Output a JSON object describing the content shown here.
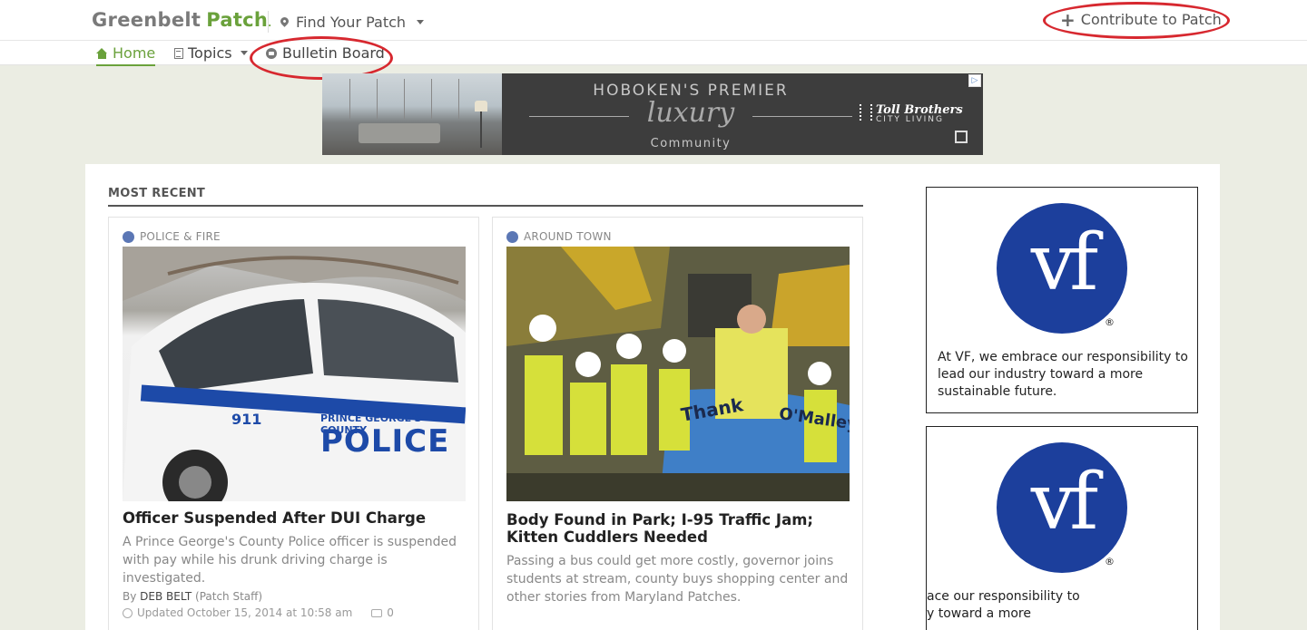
{
  "header": {
    "brand_town": "Greenbelt",
    "brand_patch": "Patch",
    "find_label": "Find Your Patch",
    "contribute_label": "Contribute to Patch"
  },
  "nav": {
    "home": "Home",
    "topics": "Topics",
    "bulletin": "Bulletin Board"
  },
  "ad_banner": {
    "headline": "HOBOKEN'S PREMIER",
    "script": "luxury",
    "sub": "Community",
    "brand": "Toll Brothers",
    "brand_sub": "CITY LIVING"
  },
  "section_title": "MOST RECENT",
  "articles": [
    {
      "category": "POLICE & FIRE",
      "image_text_unit": "911",
      "image_text_county": "PRINCE GEORGE'S COUNTY",
      "image_text_police": "POLICE",
      "title": "Officer Suspended After DUI Charge",
      "summary": "A Prince George's County Police officer is suspended with pay while his drunk driving charge is investigated.",
      "by_prefix": "By ",
      "author": "DEB BELT",
      "author_role": " (Patch Staff)",
      "updated": "Updated October 15, 2014 at 10:58 am",
      "comments": "0"
    },
    {
      "category": "AROUND TOWN",
      "image_banner_text": "Thank",
      "image_banner_text2": "O'Malley",
      "title": "Body Found in Park; I-95 Traffic Jam; Kitten Cuddlers Needed",
      "summary": "Passing a bus could get more costly, governor joins students at stream, county buys shopping center and other stories from Maryland Patches."
    }
  ],
  "sidebar_ads": [
    {
      "logo": "vf",
      "reg": "®",
      "text": "At VF, we embrace our responsibility to lead our industry toward a more sustainable future."
    },
    {
      "logo": "vf",
      "reg": "®",
      "text": "ace our responsibility to y toward a more"
    }
  ],
  "colors": {
    "brand_green": "#6aa13b",
    "highlight_red": "#d7282f",
    "vf_blue": "#1c3f9c",
    "page_bg": "#ebede3"
  }
}
